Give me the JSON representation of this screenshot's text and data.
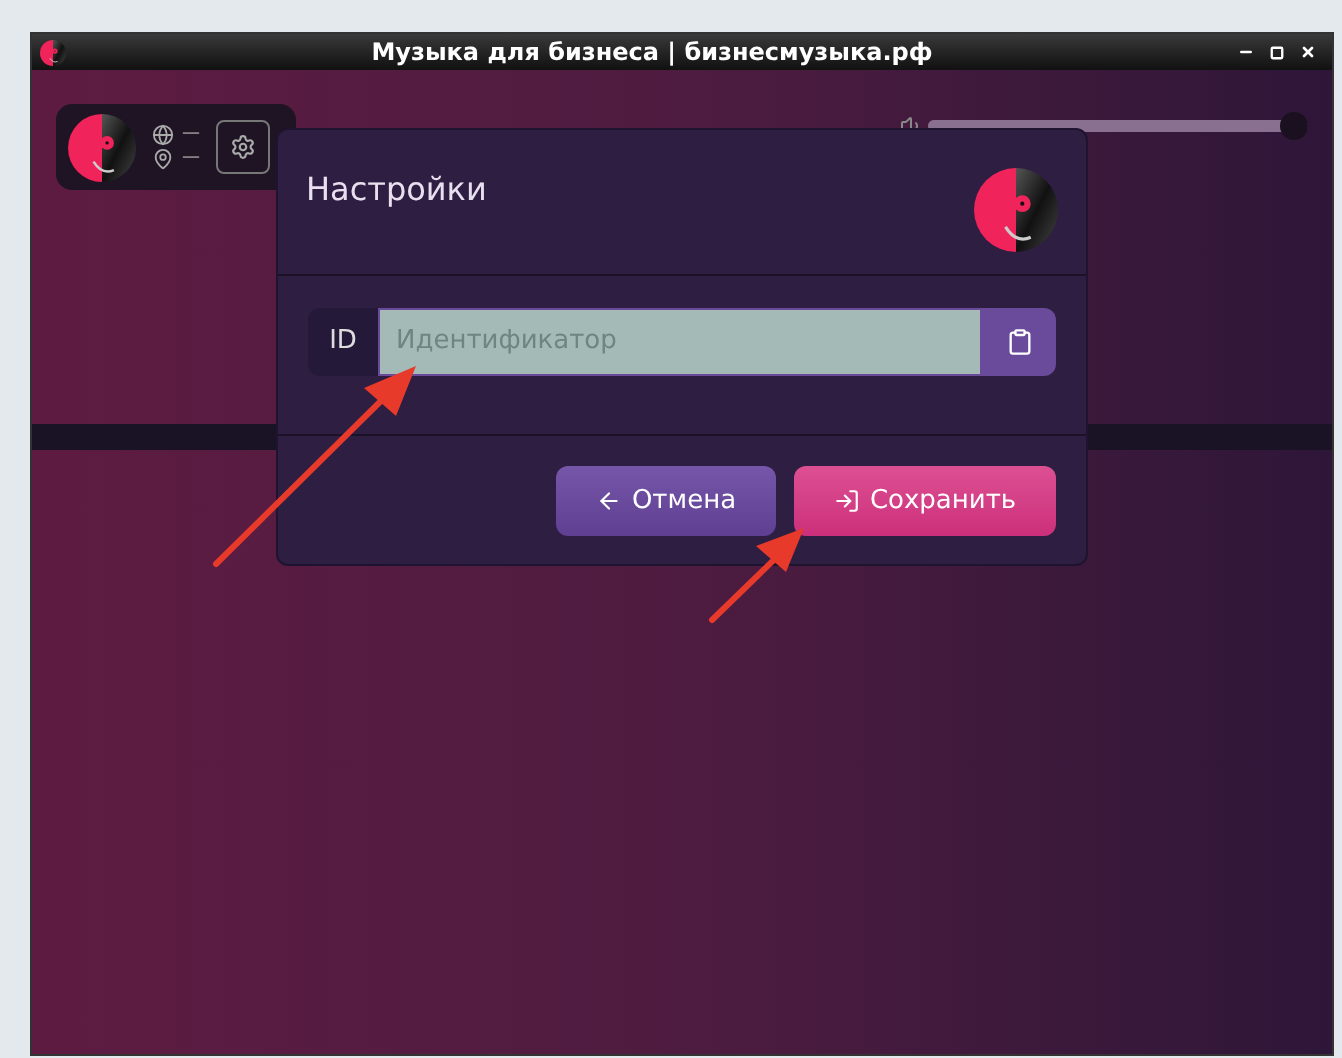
{
  "window": {
    "title": "Музыка для бизнеса | бизнесмузыка.рф"
  },
  "status": {
    "network": "—",
    "location": "—"
  },
  "volume": {
    "level": 1
  },
  "dialog": {
    "title": "Настройки",
    "id_field": {
      "label": "ID",
      "placeholder": "Идентификатор"
    },
    "buttons": [
      {
        "label": "Отмена",
        "kind": "cancel"
      },
      {
        "label": "Сохранить",
        "kind": "save"
      }
    ]
  }
}
